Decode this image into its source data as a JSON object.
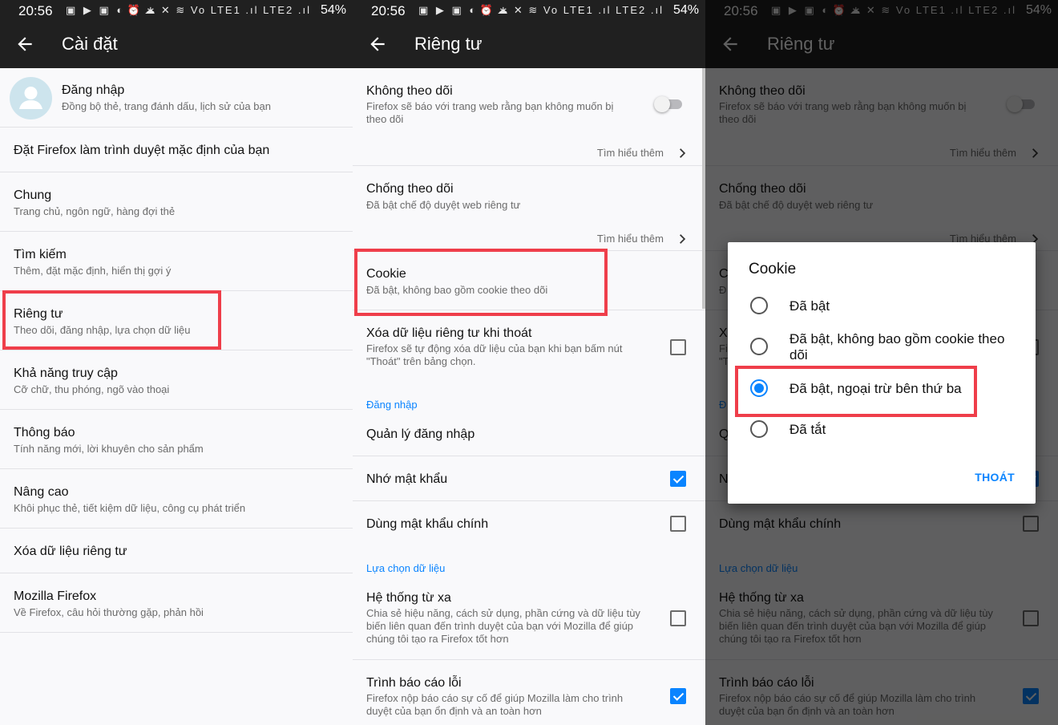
{
  "status_bar": {
    "time": "20:56",
    "left_icons": "▣ ▶ ▣ ◐ ● ☁",
    "right_icons": "⏰ ∗ ✕ ≋ Vo LTE1 .ıl LTE2 .ıl",
    "battery": "54%"
  },
  "panel1": {
    "title": "Cài đặt",
    "rows": [
      {
        "title": "Đăng nhập",
        "subtitle": "Đồng bộ thẻ, trang đánh dấu, lịch sử của bạn"
      },
      {
        "title": "Đặt Firefox làm trình duyệt mặc định của bạn"
      },
      {
        "title": "Chung",
        "subtitle": "Trang chủ, ngôn ngữ, hàng đợi thẻ"
      },
      {
        "title": "Tìm kiếm",
        "subtitle": "Thêm, đặt mặc định, hiển thị gợi ý"
      },
      {
        "title": "Riêng tư",
        "subtitle": "Theo dõi, đăng nhập, lựa chọn dữ liệu"
      },
      {
        "title": "Khả năng truy cập",
        "subtitle": "Cỡ chữ, thu phóng, ngõ vào thoại"
      },
      {
        "title": "Thông báo",
        "subtitle": "Tính năng mới, lời khuyên cho sản phẩm"
      },
      {
        "title": "Nâng cao",
        "subtitle": "Khôi phục thẻ, tiết kiệm dữ liệu, công cụ phát triển"
      },
      {
        "title": "Xóa dữ liệu riêng tư"
      },
      {
        "title": "Mozilla Firefox",
        "subtitle": "Về Firefox, câu hỏi thường gặp, phản hồi"
      }
    ]
  },
  "privacy": {
    "title": "Riêng tư",
    "do_not_track": {
      "title": "Không theo dõi",
      "subtitle_1": "Firefox sẽ báo với trang web rằng bạn không muốn bị",
      "subtitle_2": "theo dõi",
      "enabled": false
    },
    "learn_more": "Tìm hiểu thêm",
    "tracking_protection": {
      "title": "Chống theo dõi",
      "subtitle": "Đã bật chế độ duyệt web riêng tư"
    },
    "cookie": {
      "title": "Cookie",
      "subtitle": "Đã bật, không bao gồm cookie theo dõi"
    },
    "clear_on_exit": {
      "title": "Xóa dữ liệu riêng tư khi thoát",
      "subtitle_1": "Firefox sẽ tự động xóa dữ liệu của bạn khi bạn bấm nút",
      "subtitle_2": "\"Thoát\" trên bảng chọn.",
      "checked": false
    },
    "logins_header": "Đăng nhập",
    "manage_logins": "Quản lý đăng nhập",
    "remember_passwords": {
      "title": "Nhớ mật khẩu",
      "checked": true
    },
    "master_password": {
      "title": "Dùng mật khẩu chính",
      "checked": false
    },
    "data_choices_header": "Lựa chọn dữ liệu",
    "telemetry": {
      "title": "Hệ thống từ xa",
      "subtitle_1": "Chia sẻ hiệu năng, cách sử dụng, phần cứng và dữ liệu tùy",
      "subtitle_2": "biến liên quan đến trình duyệt của bạn với Mozilla để giúp",
      "subtitle_3": "chúng tôi tạo ra Firefox tốt hơn",
      "checked": false
    },
    "crash_reporter": {
      "title": "Trình báo cáo lỗi",
      "subtitle_1": "Firefox nộp báo cáo sự cố để giúp Mozilla làm cho trình",
      "subtitle_2": "duyệt của bạn ổn định và an toàn hơn",
      "checked": true
    }
  },
  "panel3_partial": {
    "cookie_stub": "C",
    "cookie_sub_stub": "Đ",
    "clear_stub": "X",
    "clear_sub_stub_1": "Fi",
    "clear_sub_stub_2": "\"T",
    "logins_stub": "Đ",
    "manage_stub": "Q",
    "remember_stub": "N"
  },
  "cookie_dialog": {
    "title": "Cookie",
    "options": [
      {
        "label": "Đã bật",
        "selected": false
      },
      {
        "label": "Đã bật, không bao gồm cookie theo dõi",
        "selected": false
      },
      {
        "label": "Đã bật, ngoại trừ bên thứ ba",
        "selected": true
      },
      {
        "label": "Đã tắt",
        "selected": false
      }
    ],
    "exit_button": "THOÁT"
  },
  "colors": {
    "accent": "#0a84ff",
    "toolbar": "#202020",
    "highlight": "#ef3e4a",
    "background": "#f9f9fb"
  }
}
